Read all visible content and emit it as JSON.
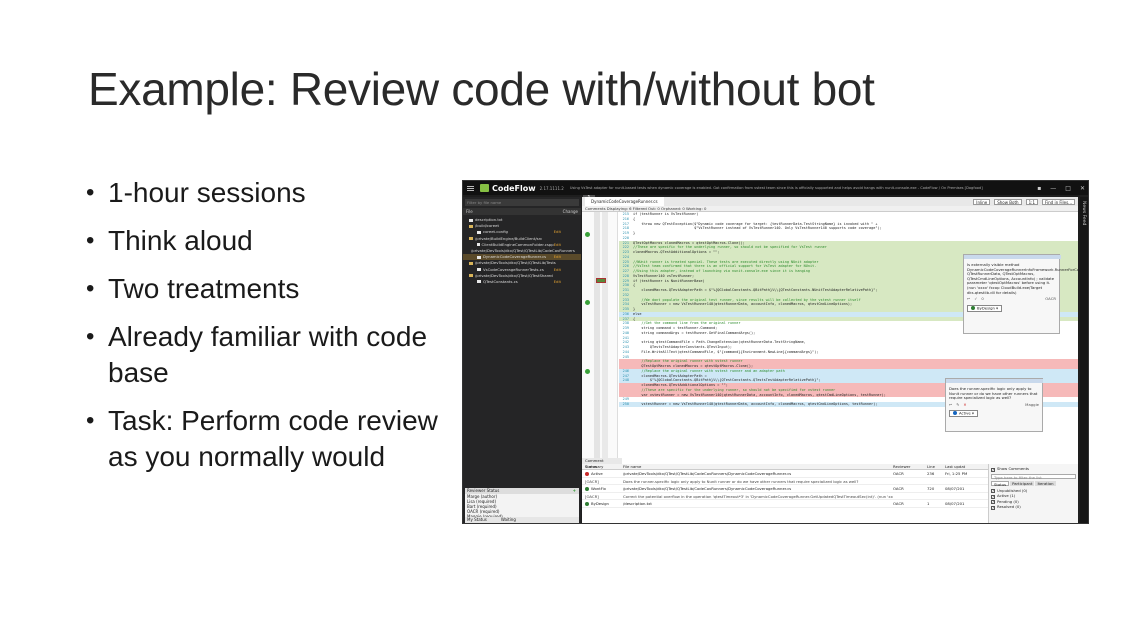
{
  "slide": {
    "title": "Example: Review code with/without bot",
    "bullets": [
      "1-hour sessions",
      "Think aloud",
      "Two treatments",
      "Already familiar with code base",
      "Task: Perform code review as you normally would"
    ]
  },
  "app": {
    "name": "CodeFlow",
    "version": "2.17.1111.2",
    "banner": "Using VsTest adapter for nunit-based tests when dynamic coverage is enabled. Got confirmation from vstest team since this is officially supported and helps avoid hangs with nunit-console.exe - CodeFlow / On Premises [Dogfood]",
    "iteration": "1",
    "news_feed_label": "News Feed",
    "window_controls": [
      "▪",
      "—",
      "□",
      "✕"
    ]
  },
  "left_panel": {
    "filter_placeholder": "Filter by file name",
    "file_header": "File",
    "change_header": "Change",
    "files": [
      {
        "name": "description.txt",
        "indent": 0,
        "type": "doc",
        "change": ""
      },
      {
        "name": "/build/coreet",
        "indent": 0,
        "type": "folder",
        "change": ""
      },
      {
        "name": "coreet.config",
        "indent": 1,
        "type": "doc",
        "change": "Edit"
      },
      {
        "name": "/private/BuildEngine/BuildClient/src",
        "indent": 0,
        "type": "folder",
        "change": ""
      },
      {
        "name": "ClientBuildEngineCommonFolder.cspp",
        "indent": 1,
        "type": "doc",
        "change": "Edit"
      },
      {
        "name": "/private/DevTools/dkx/QTest/QTestLib/CodeCovRunners",
        "indent": 0,
        "type": "folder",
        "change": ""
      },
      {
        "name": "DynamicCodeCoverageRunner.cs",
        "indent": 1,
        "type": "doc",
        "change": "Edit",
        "selected": true
      },
      {
        "name": "/private/DevTools/dkx/QTest/QTestLib/Tests",
        "indent": 0,
        "type": "folder",
        "change": ""
      },
      {
        "name": "VsCodeCoverageRunnerTests.cs",
        "indent": 1,
        "type": "doc",
        "change": "Edit"
      },
      {
        "name": "/private/DevTools/dkx/QTest/QTestShared",
        "indent": 0,
        "type": "folder",
        "change": ""
      },
      {
        "name": "QTestConstants.cs",
        "indent": 1,
        "type": "doc",
        "change": "Edit"
      }
    ]
  },
  "reviewer_status": {
    "title": "Reviewer Status",
    "rows": [
      "Marge (author)",
      "Lisa (required)",
      "Bart (required)",
      "OACR (required)",
      "Maggie (required)"
    ],
    "footer_label": "My Status",
    "footer_value": "Waiting"
  },
  "editor": {
    "file_tab": "DynamicCodeCoverageRunner.cs",
    "toolbar": [
      "Inline",
      "Show Both",
      "1:1",
      "Find in Files..."
    ],
    "comment_bar": "Comments  Displaying: 6  Filtered Out: 0  Orphaned: 0  Working: 0",
    "zoom": "100 %",
    "lines": [
      {
        "n": "215",
        "t": "if (testRunner is VsTestRunner)",
        "k": ""
      },
      {
        "n": "216",
        "t": "{",
        "k": ""
      },
      {
        "n": "217",
        "t": "    throw new QTestException($\"Dynamic code coverage for target: {testRunnerData.TestStringName} is invoked with \" +",
        "k": ""
      },
      {
        "n": "218",
        "t": "                             $\"VsTestRunner instead of VsTestRunner140. Only VsTestRunner140 supports code coverage\");",
        "k": ""
      },
      {
        "n": "219",
        "t": "}",
        "k": ""
      },
      {
        "n": "220",
        "t": "",
        "k": ""
      },
      {
        "n": "221",
        "t": "QTestOptMacros clonedMacros = qtestOptMacros.Clone();",
        "k": "mod"
      },
      {
        "n": "222",
        "t": "//These are specific for the underlying runner, so should not be specified for VsTest runner",
        "k": "mod cmt"
      },
      {
        "n": "223",
        "t": "clonedMacros.QTestAdditionalOptions = \"\";",
        "k": "mod"
      },
      {
        "n": "224",
        "t": "",
        "k": "mod"
      },
      {
        "n": "225",
        "t": "//NUnit runner is treated special. These tests are executed directly using NUnit adapter",
        "k": "mod cmt"
      },
      {
        "n": "226",
        "t": "//VsTest team confirmed that there is an official support for VsTest adapter for NUnit.",
        "k": "mod cmt"
      },
      {
        "n": "227",
        "t": "//Using this adapter, instead of launching via nunit-console.exe since it is hanging",
        "k": "mod cmt"
      },
      {
        "n": "228",
        "t": "VsTestRunner140 vsTestRunner;",
        "k": "mod"
      },
      {
        "n": "229",
        "t": "if (testRunner is NunitRunnerBase)",
        "k": "mod"
      },
      {
        "n": "230",
        "t": "{",
        "k": "mod"
      },
      {
        "n": "231",
        "t": "    clonedMacros.QTestAdapterPath = $\"%{QGlobalConstants.QBitPath}%\\\\{QTestConstants.NUnitTestAdapterRelativePath}\";",
        "k": "mod"
      },
      {
        "n": "232",
        "t": "",
        "k": "mod"
      },
      {
        "n": "233",
        "t": "    //We dont populate the original test runner, since results will be collected by the vstest runner itself",
        "k": "mod cmt"
      },
      {
        "n": "234",
        "t": "    vsTestRunner = new VsTestRunner140(qtestRunnerData, accountInfo, clonedMacros, qtestCmdLineOptions);",
        "k": "mod"
      },
      {
        "n": "235",
        "t": "}",
        "k": "mod"
      },
      {
        "n": "236",
        "t": "else",
        "k": "add"
      },
      {
        "n": "237",
        "t": "{",
        "k": "mod"
      },
      {
        "n": "238",
        "t": "    //Get the command line from the original runner",
        "k": "cmt"
      },
      {
        "n": "239",
        "t": "    string command = testRunner.Command;",
        "k": ""
      },
      {
        "n": "240",
        "t": "    string commandArgs = testRunner.GetFinalCommandArgs();",
        "k": ""
      },
      {
        "n": "241",
        "t": "",
        "k": ""
      },
      {
        "n": "242",
        "t": "    string qtestCommandFile = Path.ChangeExtension(qtestRunnerData.TestStringName,",
        "k": ""
      },
      {
        "n": "243",
        "t": "        QTestsTestAdapterConstants.QTestInput);",
        "k": ""
      },
      {
        "n": "244",
        "t": "    File.WriteAllText(qtestCommandFile, $\"{command}{Environment.NewLine}{commandArgs}\");",
        "k": ""
      },
      {
        "n": "245",
        "t": "",
        "k": ""
      },
      {
        "n": "",
        "t": "    //Replace the original runner with vstest runner",
        "k": "del cmt"
      },
      {
        "n": "",
        "t": "    QTestOptMacros clonedMacros = qtestOptMacros.Clone();",
        "k": "del"
      },
      {
        "n": "246",
        "t": "    //Replace the original runner with vstest runner and an adapter path",
        "k": "add cmt"
      },
      {
        "n": "247",
        "t": "    clonedMacros.QTestAdapterPath =",
        "k": "add"
      },
      {
        "n": "248",
        "t": "        $\"%{QGlobalConstants.QBitPath}%\\\\{QTestConstants.QTestsTestAdapterRelativePath}\";",
        "k": "add"
      },
      {
        "n": "",
        "t": "    clonedMacros.QTestAdditionalOptions = \"\";",
        "k": "del"
      },
      {
        "n": "",
        "t": "    //These are specific for the underlying runner, so should not be specified for vstest runner",
        "k": "del cmt"
      },
      {
        "n": "",
        "t": "    var vstestRunner = new VsTestRunner140(qtestRunnerData, accountInfo, clonedMacros, qtestCmdLineOptions, testRunner);",
        "k": "del"
      },
      {
        "n": "249",
        "t": "",
        "k": ""
      },
      {
        "n": "250",
        "t": "    vstestRunner = new VsTestRunner140(qtestRunnerData, accountInfo, clonedMacros, qtestCmdLineOptions, testRunner);",
        "k": "add"
      }
    ]
  },
  "comment_1": {
    "text": "Is externally visible method DynamicCodeCoverageRunnerInfoFramework.RunnerForCoverage(PrimaryRunner, QTestRunnerData, QTestOptMacros, QTestCmdLineOptions, AccountInfo) ; validate parameter 'qtestOptMacros' before using it. (nun 'xxxx' fxcop CloudBuild.exe/Target dks.qtestlib.dll for details)",
    "author": "OACR",
    "likes": "0",
    "status": "ByDesign"
  },
  "comment_2": {
    "text": "Does the runner-specific logic only apply to Nunit runner or do we have other runners that require specialized logic as well?",
    "author": "Maggie",
    "status": "Active"
  },
  "comment_summary": {
    "tab": "Comment Summary",
    "columns": [
      "Status",
      "File name",
      "Reviewer",
      "Line",
      "Last updat"
    ],
    "rows": [
      {
        "status": "Active",
        "color": "#c62828",
        "file": "/private/DevTools/dkx/QTest/QTestLib/CodeCovRunners/DynamicCodeCoverageRunner.cs",
        "reviewer": "OACR",
        "line": "236",
        "date": "Fri, 1:25 PM"
      },
      {
        "status": "[OACR]",
        "color": "",
        "file": "Does the runner-specific logic only apply to Nunit runner or do we have other runners that require specialized logic as well?",
        "reviewer": "",
        "line": "",
        "date": ""
      },
      {
        "status": "WontFix",
        "color": "#2e7d32",
        "file": "/private/DevTools/dkx/QTest/QTestLib/CodeCovRunners/DynamicCodeCoverageRunner.cs",
        "reviewer": "OACR",
        "line": "720",
        "date": "08/07/201"
      },
      {
        "status": "[OACR]",
        "color": "",
        "file": "Correct the potential overflow in the operation 'qtestTimeout*3' in 'DynamicCodeCoverageRunner.GetUpdatedQTestTimeoutSec(int)'. (nun 'xxxx' fxcop CloudBuild.exe/Target dks.qtestlib.dll 'for d",
        "reviewer": "",
        "line": "",
        "date": ""
      },
      {
        "status": "ByDesign",
        "color": "#2e7d32",
        "file": "/description.txt",
        "reviewer": "OACR",
        "line": "1",
        "date": "08/07/201"
      }
    ]
  },
  "side_filter": {
    "show_comments_label": "Show Comments",
    "filter_placeholder": "Type here to filter the list",
    "tabs": [
      "Status",
      "Participant",
      "Iteration"
    ],
    "items": [
      "Unpublished (0)",
      "Active (1)",
      "Pending (0)",
      "Resolved (0)"
    ]
  }
}
